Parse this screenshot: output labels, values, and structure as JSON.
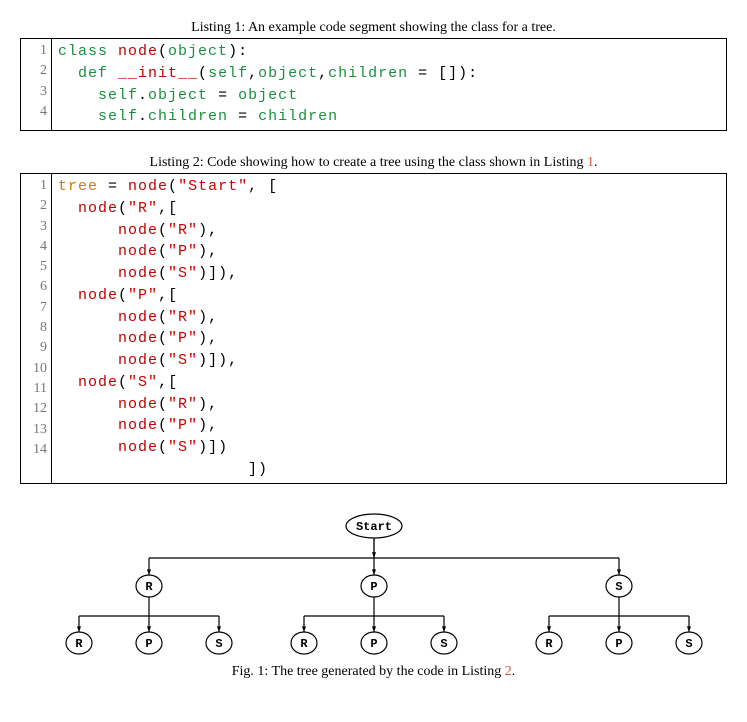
{
  "listing1": {
    "caption": "Listing 1: An example code segment showing the class for a tree.",
    "lines": [
      1,
      2,
      3,
      4
    ],
    "code": [
      {
        "indent": 0,
        "tokens": [
          {
            "t": "class ",
            "c": "kw"
          },
          {
            "t": "node",
            "c": "cls"
          },
          {
            "t": "(",
            "c": "black"
          },
          {
            "t": "object",
            "c": "kw"
          },
          {
            "t": "):",
            "c": "black"
          }
        ]
      },
      {
        "indent": 1,
        "tokens": [
          {
            "t": "def ",
            "c": "kw"
          },
          {
            "t": "__init__",
            "c": "cls"
          },
          {
            "t": "(",
            "c": "black"
          },
          {
            "t": "self",
            "c": "kw"
          },
          {
            "t": ",",
            "c": "black"
          },
          {
            "t": "object",
            "c": "kw"
          },
          {
            "t": ",",
            "c": "black"
          },
          {
            "t": "children",
            "c": "kw"
          },
          {
            "t": " = []):",
            "c": "black"
          }
        ]
      },
      {
        "indent": 2,
        "tokens": [
          {
            "t": "self",
            "c": "kw"
          },
          {
            "t": ".",
            "c": "black"
          },
          {
            "t": "object",
            "c": "kw"
          },
          {
            "t": " = ",
            "c": "black"
          },
          {
            "t": "object",
            "c": "kw"
          }
        ]
      },
      {
        "indent": 2,
        "tokens": [
          {
            "t": "self",
            "c": "kw"
          },
          {
            "t": ".",
            "c": "black"
          },
          {
            "t": "children",
            "c": "kw"
          },
          {
            "t": " = ",
            "c": "black"
          },
          {
            "t": "children",
            "c": "kw"
          }
        ]
      }
    ]
  },
  "listing2": {
    "caption_prefix": "Listing 2: Code showing how to create a tree using the class shown in Listing ",
    "caption_ref": "1",
    "caption_suffix": ".",
    "lines": [
      1,
      2,
      3,
      4,
      5,
      6,
      7,
      8,
      9,
      10,
      11,
      12,
      13,
      14
    ],
    "code": [
      {
        "indent": 0,
        "tokens": [
          {
            "t": "tree",
            "c": "tok-tree"
          },
          {
            "t": " = ",
            "c": "black"
          },
          {
            "t": "node",
            "c": "cls"
          },
          {
            "t": "(",
            "c": "black"
          },
          {
            "t": "\"Start\"",
            "c": "str"
          },
          {
            "t": ", [",
            "c": "black"
          }
        ]
      },
      {
        "indent": 1,
        "tokens": [
          {
            "t": "node",
            "c": "cls"
          },
          {
            "t": "(",
            "c": "black"
          },
          {
            "t": "\"R\"",
            "c": "str"
          },
          {
            "t": ",[",
            "c": "black"
          }
        ]
      },
      {
        "indent": 3,
        "tokens": [
          {
            "t": "node",
            "c": "cls"
          },
          {
            "t": "(",
            "c": "black"
          },
          {
            "t": "\"R\"",
            "c": "str"
          },
          {
            "t": "),",
            "c": "black"
          }
        ]
      },
      {
        "indent": 3,
        "tokens": [
          {
            "t": "node",
            "c": "cls"
          },
          {
            "t": "(",
            "c": "black"
          },
          {
            "t": "\"P\"",
            "c": "str"
          },
          {
            "t": "),",
            "c": "black"
          }
        ]
      },
      {
        "indent": 3,
        "tokens": [
          {
            "t": "node",
            "c": "cls"
          },
          {
            "t": "(",
            "c": "black"
          },
          {
            "t": "\"S\"",
            "c": "str"
          },
          {
            "t": ")]),",
            "c": "black"
          }
        ]
      },
      {
        "indent": 1,
        "tokens": [
          {
            "t": "node",
            "c": "cls"
          },
          {
            "t": "(",
            "c": "black"
          },
          {
            "t": "\"P\"",
            "c": "str"
          },
          {
            "t": ",[",
            "c": "black"
          }
        ]
      },
      {
        "indent": 3,
        "tokens": [
          {
            "t": "node",
            "c": "cls"
          },
          {
            "t": "(",
            "c": "black"
          },
          {
            "t": "\"R\"",
            "c": "str"
          },
          {
            "t": "),",
            "c": "black"
          }
        ]
      },
      {
        "indent": 3,
        "tokens": [
          {
            "t": "node",
            "c": "cls"
          },
          {
            "t": "(",
            "c": "black"
          },
          {
            "t": "\"P\"",
            "c": "str"
          },
          {
            "t": "),",
            "c": "black"
          }
        ]
      },
      {
        "indent": 3,
        "tokens": [
          {
            "t": "node",
            "c": "cls"
          },
          {
            "t": "(",
            "c": "black"
          },
          {
            "t": "\"S\"",
            "c": "str"
          },
          {
            "t": ")]),",
            "c": "black"
          }
        ]
      },
      {
        "indent": 1,
        "tokens": [
          {
            "t": "node",
            "c": "cls"
          },
          {
            "t": "(",
            "c": "black"
          },
          {
            "t": "\"S\"",
            "c": "str"
          },
          {
            "t": ",[",
            "c": "black"
          }
        ]
      },
      {
        "indent": 3,
        "tokens": [
          {
            "t": "node",
            "c": "cls"
          },
          {
            "t": "(",
            "c": "black"
          },
          {
            "t": "\"R\"",
            "c": "str"
          },
          {
            "t": "),",
            "c": "black"
          }
        ]
      },
      {
        "indent": 3,
        "tokens": [
          {
            "t": "node",
            "c": "cls"
          },
          {
            "t": "(",
            "c": "black"
          },
          {
            "t": "\"P\"",
            "c": "str"
          },
          {
            "t": "),",
            "c": "black"
          }
        ]
      },
      {
        "indent": 3,
        "tokens": [
          {
            "t": "node",
            "c": "cls"
          },
          {
            "t": "(",
            "c": "black"
          },
          {
            "t": "\"S\"",
            "c": "str"
          },
          {
            "t": ")])",
            "c": "black"
          }
        ]
      },
      {
        "indent": 0,
        "tokens": [
          {
            "t": "                   ])",
            "c": "black"
          }
        ]
      }
    ]
  },
  "figure": {
    "root": "Start",
    "mid_nodes": [
      "R",
      "P",
      "S"
    ],
    "leaf_nodes": [
      "R",
      "P",
      "S",
      "R",
      "P",
      "S",
      "R",
      "P",
      "S"
    ],
    "caption_prefix": "Fig. 1: The tree generated by the code in Listing ",
    "caption_ref": "2",
    "caption_suffix": "."
  }
}
